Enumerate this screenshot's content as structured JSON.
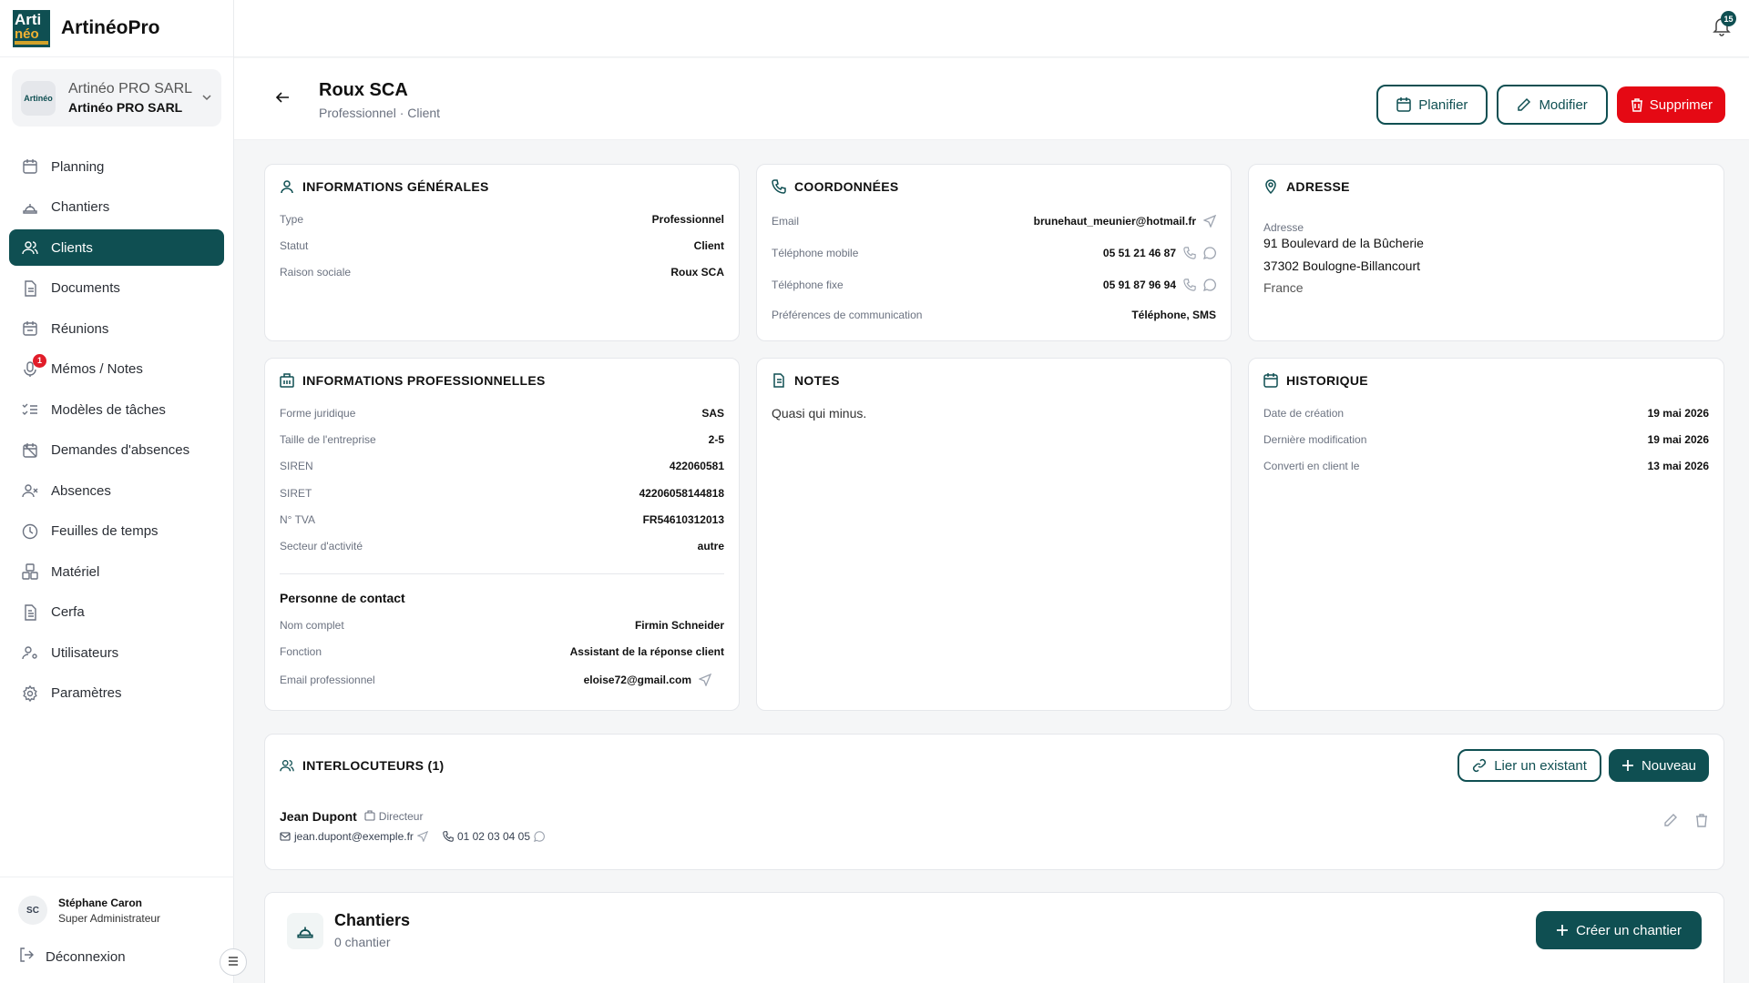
{
  "app": {
    "logo_top": "Arti",
    "logo_bottom": "néo",
    "name": "ArtinéoPro"
  },
  "company": {
    "line1": "Artinéo PRO SARL",
    "line2": "Artinéo PRO SARL",
    "logo_text": "Artinéo"
  },
  "sidebar": {
    "items": [
      {
        "label": "Planning",
        "icon": "calendar-icon"
      },
      {
        "label": "Chantiers",
        "icon": "hard-hat-icon"
      },
      {
        "label": "Clients",
        "icon": "users-icon",
        "active": true
      },
      {
        "label": "Documents",
        "icon": "document-icon"
      },
      {
        "label": "Réunions",
        "icon": "calendar-meeting-icon"
      },
      {
        "label": "Mémos / Notes",
        "icon": "mic-icon",
        "badge": "1"
      },
      {
        "label": "Modèles de tâches",
        "icon": "list-check-icon"
      },
      {
        "label": "Demandes d'absences",
        "icon": "calendar-off-icon"
      },
      {
        "label": "Absences",
        "icon": "user-x-icon"
      },
      {
        "label": "Feuilles de temps",
        "icon": "clock-icon"
      },
      {
        "label": "Matériel",
        "icon": "boxes-icon"
      },
      {
        "label": "Cerfa",
        "icon": "file-text-icon"
      },
      {
        "label": "Utilisateurs",
        "icon": "user-cog-icon"
      },
      {
        "label": "Paramètres",
        "icon": "gear-icon"
      }
    ]
  },
  "user": {
    "initials": "SC",
    "name": "Stéphane Caron",
    "role": "Super Administrateur",
    "logout": "Déconnexion"
  },
  "notifications": {
    "count": "15"
  },
  "header": {
    "title": "Roux SCA",
    "subtitle": "Professionnel · Client",
    "btn_plan": "Planifier",
    "btn_edit": "Modifier",
    "btn_delete": "Supprimer"
  },
  "general": {
    "title": "INFORMATIONS GÉNÉRALES",
    "rows": [
      {
        "k": "Type",
        "v": "Professionnel"
      },
      {
        "k": "Statut",
        "v": "Client"
      },
      {
        "k": "Raison sociale",
        "v": "Roux SCA"
      }
    ]
  },
  "coords": {
    "title": "COORDONNÉES",
    "rows": [
      {
        "k": "Email",
        "v": "brunehaut_meunier@hotmail.fr"
      },
      {
        "k": "Téléphone mobile",
        "v": "05 51 21 46 87"
      },
      {
        "k": "Téléphone fixe",
        "v": "05 91 87 96 94"
      },
      {
        "k": "Préférences de communication",
        "v": "Téléphone, SMS"
      }
    ]
  },
  "address": {
    "title": "ADRESSE",
    "label": "Adresse",
    "line1": "91 Boulevard de la Bûcherie",
    "line2": "37302 Boulogne-Billancourt",
    "line3": "France"
  },
  "pro": {
    "title": "INFORMATIONS PROFESSIONNELLES",
    "rows": [
      {
        "k": "Forme juridique",
        "v": "SAS"
      },
      {
        "k": "Taille de l'entreprise",
        "v": "2-5"
      },
      {
        "k": "SIREN",
        "v": "422060581"
      },
      {
        "k": "SIRET",
        "v": "42206058144818"
      },
      {
        "k": "N° TVA",
        "v": "FR54610312013"
      },
      {
        "k": "Secteur d'activité",
        "v": "autre"
      }
    ],
    "contact_title": "Personne de contact",
    "contact_rows": [
      {
        "k": "Nom complet",
        "v": "Firmin Schneider"
      },
      {
        "k": "Fonction",
        "v": "Assistant de la réponse client"
      },
      {
        "k": "Email professionnel",
        "v": "eloise72@gmail.com"
      }
    ]
  },
  "notes": {
    "title": "NOTES",
    "text": "Quasi qui minus."
  },
  "history": {
    "title": "HISTORIQUE",
    "rows": [
      {
        "k": "Date de création",
        "v": "19 mai 2026"
      },
      {
        "k": "Dernière modification",
        "v": "19 mai 2026"
      },
      {
        "k": "Converti en client le",
        "v": "13 mai 2026"
      }
    ]
  },
  "interlocutors": {
    "title": "INTERLOCUTEURS (1)",
    "btn_link": "Lier un existant",
    "btn_new": "Nouveau",
    "contact": {
      "name": "Jean Dupont",
      "role": "Directeur",
      "email": "jean.dupont@exemple.fr",
      "phone": "01 02 03 04 05"
    }
  },
  "chantiers": {
    "title": "Chantiers",
    "count": "0 chantier",
    "btn_create": "Créer un chantier"
  },
  "colors": {
    "primary": "#0f4f52",
    "danger": "#e50914",
    "badge": "#e11d2a"
  }
}
